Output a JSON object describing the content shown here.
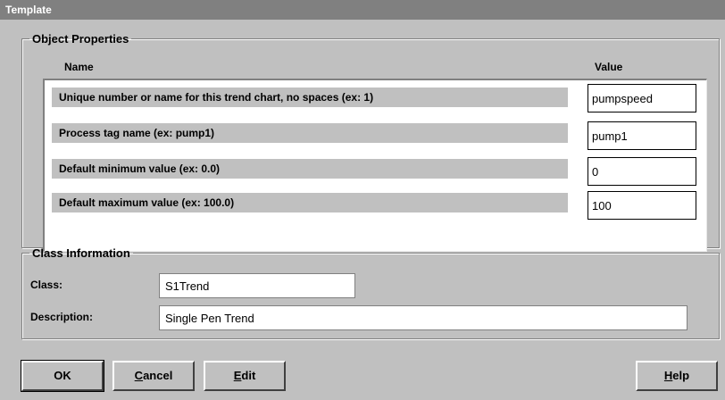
{
  "window": {
    "title": "Template"
  },
  "object_properties": {
    "legend": "Object Properties",
    "name_header": "Name",
    "value_header": "Value",
    "rows": [
      {
        "label": "Unique number or name for this trend chart, no spaces (ex: 1)",
        "value": "pumpspeed"
      },
      {
        "label": "Process tag name (ex: pump1)",
        "value": "pump1"
      },
      {
        "label": "Default minimum value (ex: 0.0)",
        "value": "0"
      },
      {
        "label": "Default maximum value (ex: 100.0)",
        "value": "100"
      }
    ]
  },
  "class_information": {
    "legend": "Class Information",
    "class_label": "Class:",
    "class_value": "S1Trend",
    "description_label": "Description:",
    "description_value": "Single Pen Trend"
  },
  "buttons": {
    "ok": "OK",
    "cancel_mnemonic": "C",
    "cancel_rest": "ancel",
    "edit_mnemonic": "E",
    "edit_rest": "dit",
    "help_mnemonic": "H",
    "help_rest": "elp"
  }
}
